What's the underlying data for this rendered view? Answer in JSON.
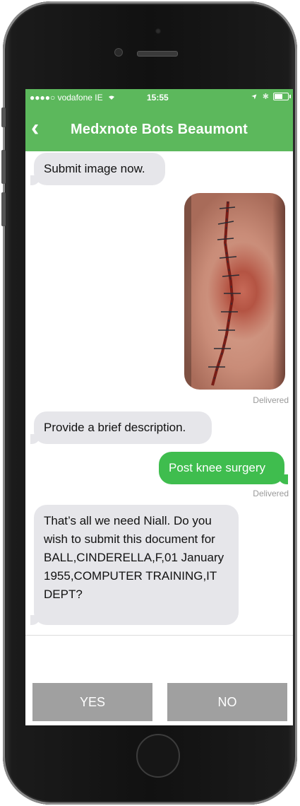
{
  "status_bar": {
    "carrier": "●●●●○ vodafone IE",
    "wifi_icon": "wifi-icon",
    "time": "15:55",
    "location_icon": "➤",
    "bluetooth_icon": "✱",
    "battery_level": 0.6
  },
  "nav": {
    "back_icon": "‹",
    "title": "Medxnote Bots  Beaumont"
  },
  "messages": {
    "m1": "Submit image now.",
    "delivered_1": "Delivered",
    "m2": "Provide a brief description.",
    "m3": "Post knee surgery",
    "delivered_2": "Delivered",
    "m4": "That’s all we need Niall.  Do you wish to submit this document for BALL,CINDERELLA,F,01 January 1955,COMPUTER TRAINING,IT DEPT?"
  },
  "actions": {
    "yes_label": "YES",
    "no_label": "NO"
  },
  "colors": {
    "brand_green": "#5cb85c",
    "outgoing_bubble": "#3fbd4e",
    "incoming_bubble": "#e6e6ea",
    "action_button": "#a0a0a0"
  }
}
